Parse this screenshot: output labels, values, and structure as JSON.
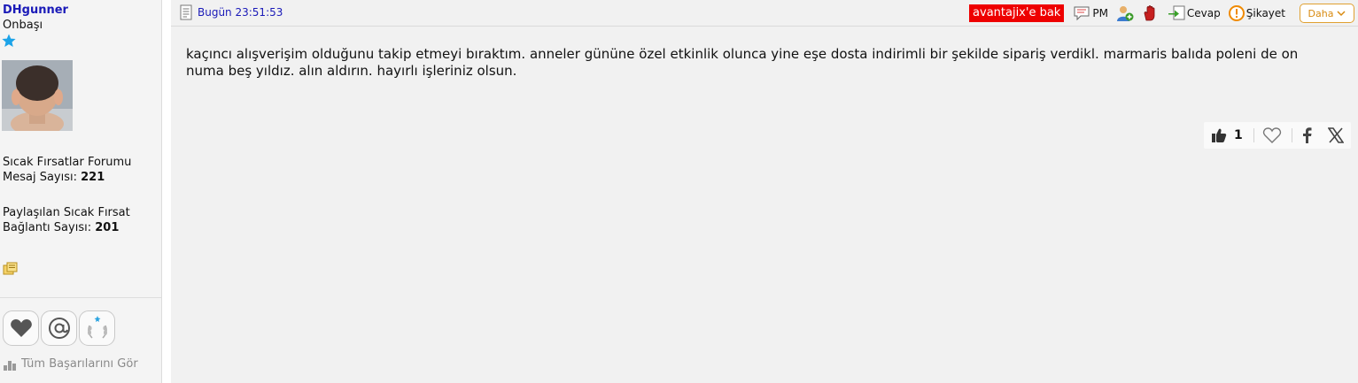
{
  "user": {
    "name": "DHgunner",
    "rank": "Onbaşı",
    "forum_label": "Sıcak Fırsatlar Forumu",
    "post_count_label": "Mesaj Sayısı:",
    "post_count": "221",
    "deals_label_1": "Paylaşılan Sıcak Fırsat",
    "deals_label_2": "Bağlantı Sayısı:",
    "deals_count": "201",
    "achievements_link": "Tüm Başarılarını Gör",
    "badges": [
      "heart-badge",
      "mention-badge",
      "laurel-badge"
    ]
  },
  "post": {
    "date": "Bugün 23:51:53",
    "body": "kaçıncı alışverişim olduğunu takip etmeyi bıraktım. anneler gününe özel etkinlik olunca yine eşe dosta indirimli bir şekilde sipariş verdikl. marmaris balıda poleni de on numa beş yıldız. alın aldırın. hayırlı işleriniz olsun.",
    "like_count": "1"
  },
  "toolbar": {
    "avantajix": "avantajix'e bak",
    "pm": "PM",
    "reply": "Cevap",
    "complaint": "Şikayet",
    "more": "Daha"
  },
  "colors": {
    "username": "#1a1ab8",
    "avantajix_bg": "#ee0000",
    "more_border": "#e0a030",
    "complaint_icon": "#f08a00"
  }
}
